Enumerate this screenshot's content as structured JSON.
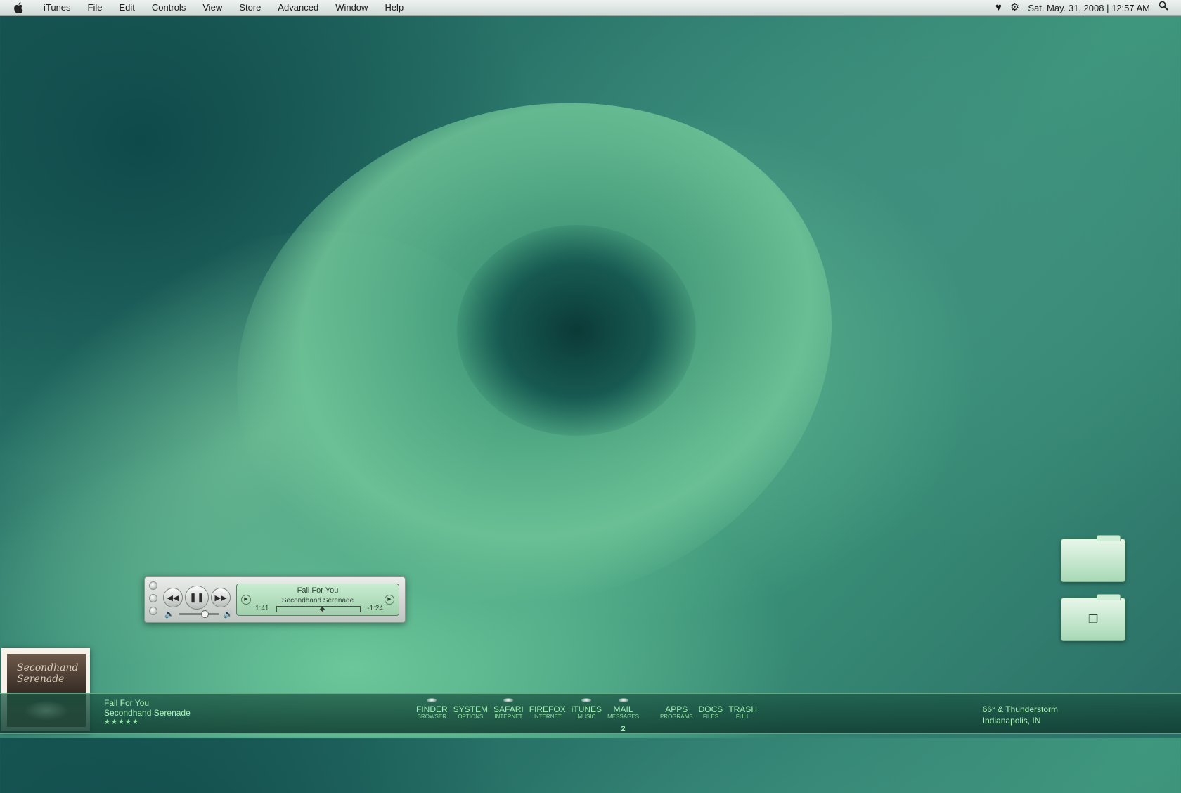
{
  "menubar": {
    "apple_icon": "apple-logo",
    "items": [
      "iTunes",
      "File",
      "Edit",
      "Controls",
      "View",
      "Store",
      "Advanced",
      "Window",
      "Help"
    ],
    "status_icons": [
      "heart-icon",
      "gear-icon",
      "spotlight-search-icon"
    ],
    "clock": "Sat. May. 31, 2008 | 12:57 AM"
  },
  "mini_player": {
    "track_title": "Fall For You",
    "artist": "Secondhand Serenade",
    "elapsed": "1:41",
    "remaining": "-1:24",
    "progress": 0.55,
    "volume": 0.62
  },
  "now_playing": {
    "title": "Fall For You",
    "artist": "Secondhand Serenade",
    "rating": "★★★★★"
  },
  "album_art": {
    "script_text": "Secondhand Serenade"
  },
  "dock": {
    "items": [
      {
        "label": "FINDER",
        "sub": "BROWSER",
        "running": true
      },
      {
        "label": "SYSTEM",
        "sub": "OPTIONS",
        "running": false
      },
      {
        "label": "SAFARI",
        "sub": "INTERNET",
        "running": true
      },
      {
        "label": "FIREFOX",
        "sub": "INTERNET",
        "running": false
      },
      {
        "label": "iTUNES",
        "sub": "MUSIC",
        "running": true
      },
      {
        "label": "MAIL",
        "sub": "MESSAGES",
        "running": true,
        "badge": "2"
      },
      {
        "label": "APPS",
        "sub": "PROGRAMS",
        "running": false
      },
      {
        "label": "DOCS",
        "sub": "FILES",
        "running": false
      },
      {
        "label": "TRASH",
        "sub": "FULL",
        "running": false
      }
    ]
  },
  "weather": {
    "line1": "66° & Thunderstorm",
    "line2": "Indianapolis, IN"
  },
  "desktop_folders": [
    {
      "icon": "apple-folder-icon"
    },
    {
      "icon": "documents-folder-icon"
    }
  ],
  "colors": {
    "accent": "#a9f2b9",
    "dock_bg": "#1c5846",
    "lcd": "#c8ecd0"
  }
}
